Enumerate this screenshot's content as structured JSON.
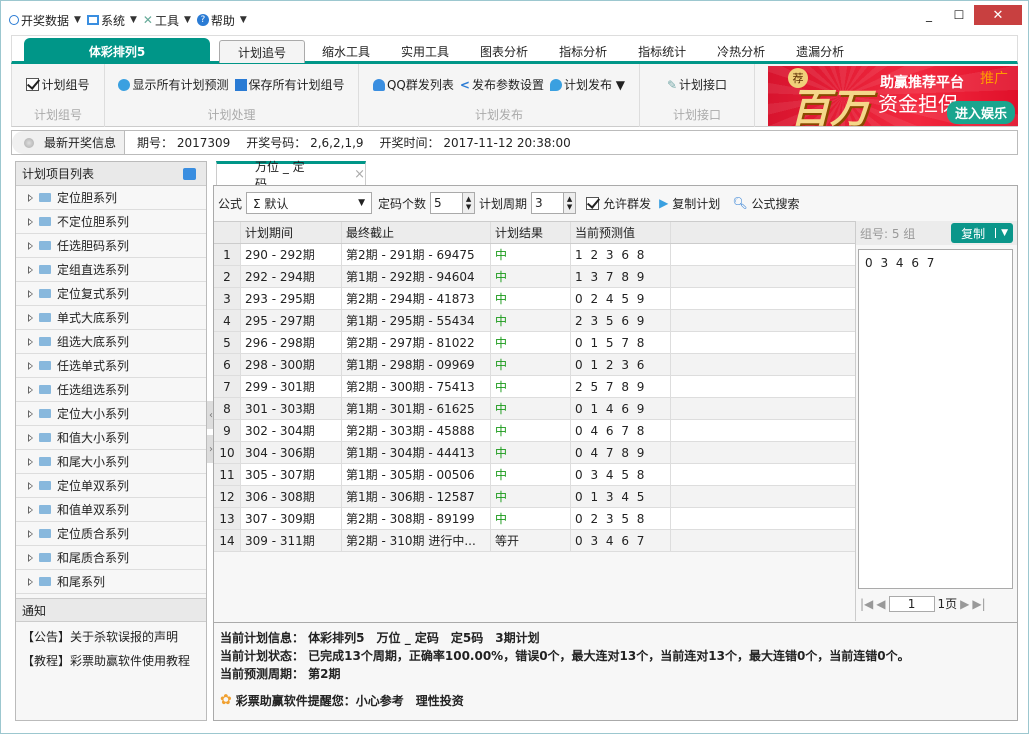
{
  "menu": [
    {
      "label": "开奖数据",
      "icon": "circle-icon"
    },
    {
      "label": "系统",
      "icon": "monitor-icon"
    },
    {
      "label": "工具",
      "icon": "tools-icon"
    },
    {
      "label": "帮助",
      "icon": "help-icon"
    }
  ],
  "window_controls": {
    "minimize": "_",
    "maximize": "☐",
    "close": "✕"
  },
  "main_tab": "体彩排列5",
  "tabs": [
    "计划追号",
    "缩水工具",
    "实用工具",
    "图表分析",
    "指标分析",
    "指标统计",
    "冷热分析",
    "遗漏分析"
  ],
  "active_tab": 0,
  "ribbon": {
    "groups": [
      {
        "caption": "计划组号",
        "items": [
          {
            "label": "计划组号",
            "icon": "checkbox-icon"
          }
        ]
      },
      {
        "caption": "计划处理",
        "items": [
          {
            "label": "显示所有计划预测",
            "icon": "display-icon"
          },
          {
            "label": "保存所有计划组号",
            "icon": "save-icon"
          }
        ]
      },
      {
        "caption": "计划发布",
        "items": [
          {
            "label": "QQ群发列表",
            "icon": "qq-icon"
          },
          {
            "label": "发布参数设置",
            "icon": "share-icon"
          },
          {
            "label": "计划发布 ▼",
            "icon": "bird-icon"
          }
        ]
      },
      {
        "caption": "计划接口",
        "items": [
          {
            "label": "计划接口",
            "icon": "plug-icon"
          }
        ]
      }
    ]
  },
  "ad": {
    "badge": "荐",
    "big": "百万",
    "line1": "助赢推荐平台",
    "line2": "资金担保",
    "tag": "推广",
    "button": "进入娱乐"
  },
  "info": {
    "label": "最新开奖信息",
    "issue": "期号： 2017309",
    "numbers": "开奖号码： 2,6,2,1,9",
    "time": "开奖时间： 2017-11-12 20:38:00"
  },
  "left": {
    "header": "计划项目列表",
    "items": [
      "定位胆系列",
      "不定位胆系列",
      "任选胆码系列",
      "定组直选系列",
      "定位复式系列",
      "单式大底系列",
      "组选大底系列",
      "任选单式系列",
      "任选组选系列",
      "定位大小系列",
      "和值大小系列",
      "和尾大小系列",
      "定位单双系列",
      "和值单双系列",
      "定位质合系列",
      "和尾质合系列",
      "和尾系列"
    ],
    "notice_header": "通知",
    "notices": [
      "【公告】关于杀软误报的声明",
      "【教程】彩票助赢软件使用教程"
    ]
  },
  "doc_tab": {
    "label": "万位 _ 定码",
    "close": "×"
  },
  "toolbar": {
    "formula_label": "公式",
    "formula_value": "Σ 默认",
    "count_label": "定码个数",
    "count_value": "5",
    "cycle_label": "计划周期",
    "cycle_value": "3",
    "allow_label": "允许群发",
    "copy_plan": "复制计划",
    "formula_search": "公式搜索"
  },
  "grid": {
    "headers": [
      "计划期间",
      "最终截止",
      "计划结果",
      "当前预测值"
    ],
    "rows": [
      [
        "1",
        "290 - 292期",
        "第2期 - 291期 - 69475",
        "中",
        "1 2 3 6 8"
      ],
      [
        "2",
        "292 - 294期",
        "第1期 - 292期 - 94604",
        "中",
        "1 3 7 8 9"
      ],
      [
        "3",
        "293 - 295期",
        "第2期 - 294期 - 41873",
        "中",
        "0 2 4 5 9"
      ],
      [
        "4",
        "295 - 297期",
        "第1期 - 295期 - 55434",
        "中",
        "2 3 5 6 9"
      ],
      [
        "5",
        "296 - 298期",
        "第2期 - 297期 - 81022",
        "中",
        "0 1 5 7 8"
      ],
      [
        "6",
        "298 - 300期",
        "第1期 - 298期 - 09969",
        "中",
        "0 1 2 3 6"
      ],
      [
        "7",
        "299 - 301期",
        "第2期 - 300期 - 75413",
        "中",
        "2 5 7 8 9"
      ],
      [
        "8",
        "301 - 303期",
        "第1期 - 301期 - 61625",
        "中",
        "0 1 4 6 9"
      ],
      [
        "9",
        "302 - 304期",
        "第2期 - 303期 - 45888",
        "中",
        "0 4 6 7 8"
      ],
      [
        "10",
        "304 - 306期",
        "第1期 - 304期 - 44413",
        "中",
        "0 4 7 8 9"
      ],
      [
        "11",
        "305 - 307期",
        "第1期 - 305期 - 00506",
        "中",
        "0 3 4 5 8"
      ],
      [
        "12",
        "306 - 308期",
        "第1期 - 306期 - 12587",
        "中",
        "0 1 3 4 5"
      ],
      [
        "13",
        "307 - 309期",
        "第2期 - 308期 - 89199",
        "中",
        "0 2 3 5 8"
      ],
      [
        "14",
        "309 - 311期",
        "第2期 - 310期 进行中...",
        "等开",
        "0 3 4 6 7"
      ]
    ]
  },
  "side": {
    "group_label": "组号: 5 组",
    "copy_button": "复制",
    "content": "0 3 4 6 7",
    "page_value": "1",
    "page_total": "1页"
  },
  "status": {
    "info": "当前计划信息： 体彩排列5　万位 _ 定码　定5码　3期计划",
    "state": "当前计划状态： 已完成13个周期，正确率100.00%，错误0个，最大连对13个，当前连对13个，最大连错0个，当前连错0个。",
    "period": "当前预测周期： 第2期",
    "tip": "彩票助赢软件提醒您：小心参考　理性投资"
  },
  "colors": {
    "accent": "#009688",
    "hit": "#1a9a1a",
    "close": "#c84040"
  }
}
